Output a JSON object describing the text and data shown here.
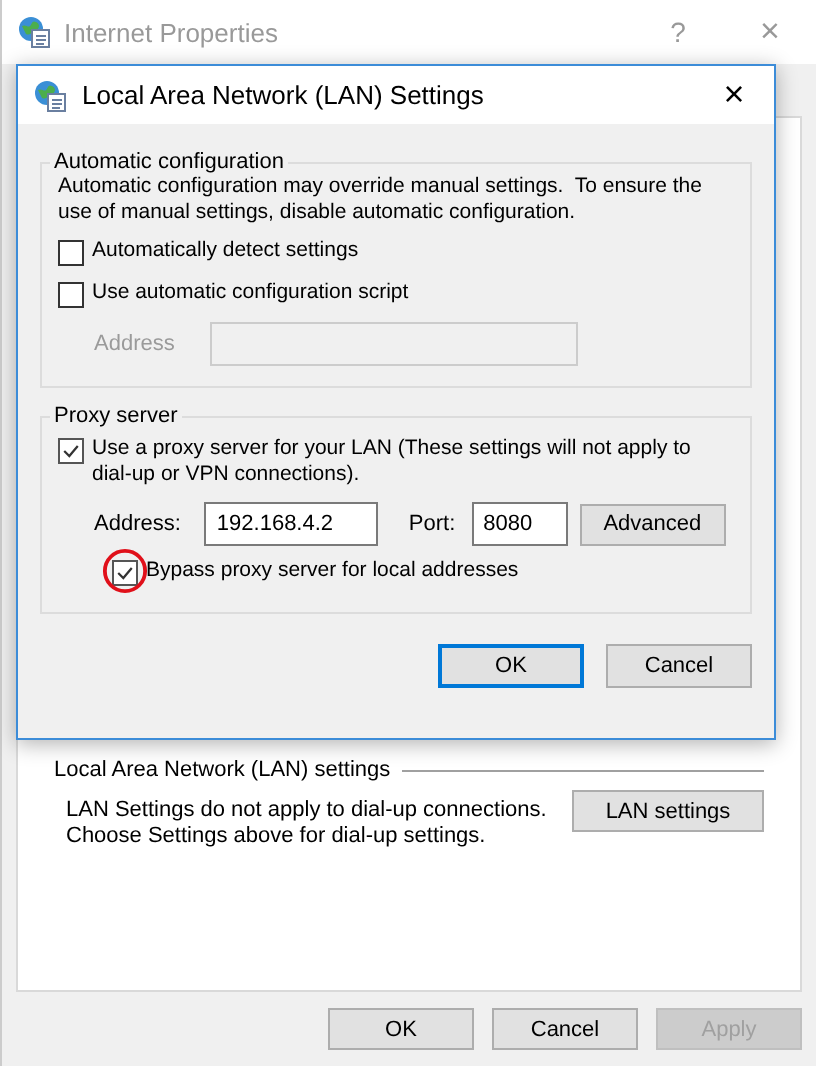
{
  "window": {
    "title": "Internet Properties",
    "active": false,
    "help": "?",
    "close": "×"
  },
  "lan_section": {
    "heading": "Local Area Network (LAN) settings",
    "description": "LAN Settings do not apply to dial-up connections.\nChoose Settings above for dial-up settings.",
    "button": "LAN settings"
  },
  "footer_buttons": [
    {
      "label": "OK",
      "disabled": false
    },
    {
      "label": "Cancel",
      "disabled": false
    },
    {
      "label": "Apply",
      "disabled": true
    }
  ],
  "dialog": {
    "title": "Local Area Network (LAN) Settings",
    "close": "×",
    "automatic_configuration": {
      "legend": "Automatic configuration",
      "description": "Automatic configuration may override manual settings.  To ensure the\nuse of manual settings, disable automatic configuration.",
      "options": [
        {
          "label": "Automatically detect settings",
          "checked": false
        },
        {
          "label": "Use automatic configuration script",
          "checked": false
        }
      ],
      "address": {
        "label": "Address",
        "disabled": true
      }
    },
    "proxy_server": {
      "legend": "Proxy server",
      "use_proxy": {
        "label": "Use a proxy server for your LAN (These settings will not apply to\ndial-up or VPN connections).",
        "checked": true
      },
      "address": {
        "label": "Address:",
        "value": "192.168.4.2"
      },
      "port": {
        "label": "Port:",
        "value": "8080"
      },
      "advanced_button": "Advanced",
      "bypass": {
        "label": "Bypass proxy server for local addresses",
        "checked": true,
        "circled": true
      }
    },
    "buttons": [
      {
        "label": "OK",
        "default": true
      },
      {
        "label": "Cancel",
        "default": false
      }
    ]
  }
}
